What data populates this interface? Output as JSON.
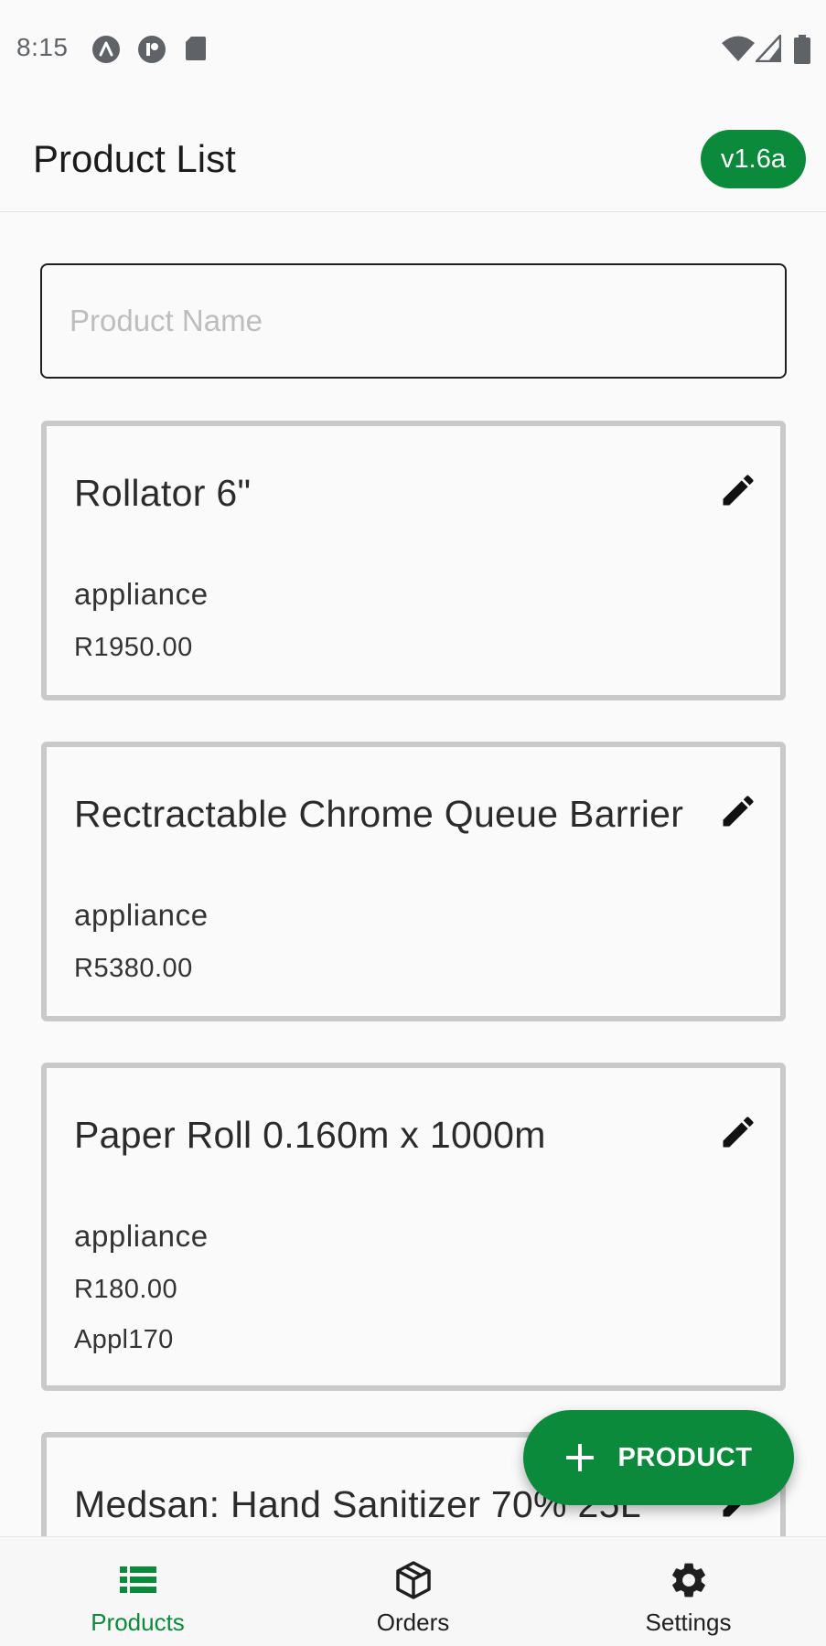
{
  "status_bar": {
    "time": "8:15",
    "left_icons": [
      "a-circle-icon",
      "p-circle-icon",
      "sd-card-icon"
    ],
    "right_icons": [
      "wifi-icon",
      "cell-signal-icon",
      "battery-icon"
    ]
  },
  "app_bar": {
    "title": "Product List",
    "version": "v1.6a"
  },
  "search": {
    "placeholder": "Product Name",
    "value": ""
  },
  "products": [
    {
      "title": "Rollator 6\"",
      "category": "appliance",
      "price": "R1950.00",
      "code": ""
    },
    {
      "title": "Rectractable Chrome Queue Barrier",
      "category": "appliance",
      "price": "R5380.00",
      "code": ""
    },
    {
      "title": "Paper Roll 0.160m x 1000m",
      "category": "appliance",
      "price": "R180.00",
      "code": "Appl170"
    },
    {
      "title": "Medsan: Hand Sanitizer 70% 25L",
      "category": "",
      "price": "",
      "code": ""
    }
  ],
  "fab": {
    "label": "PRODUCT",
    "icon": "plus-icon"
  },
  "bottom_nav": {
    "items": [
      {
        "label": "Products",
        "icon": "list-icon",
        "active": true
      },
      {
        "label": "Orders",
        "icon": "package-icon",
        "active": false
      },
      {
        "label": "Settings",
        "icon": "gear-icon",
        "active": false
      }
    ]
  },
  "colors": {
    "accent": "#0a8a3a",
    "background": "#fafafa",
    "card_border": "#c9c9c9"
  }
}
